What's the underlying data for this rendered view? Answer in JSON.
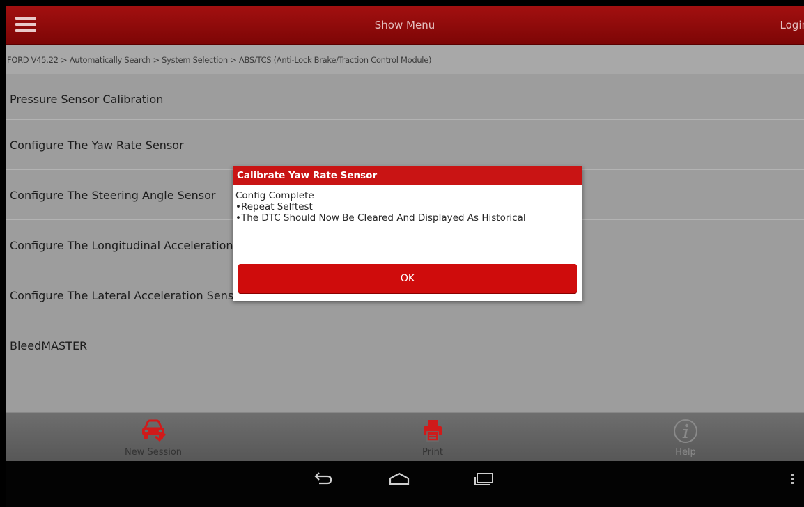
{
  "header": {
    "title": "Show Menu",
    "login_label": "Login"
  },
  "breadcrumb": "FORD V45.22 > Automatically Search > System Selection > ABS/TCS (Anti-Lock Brake/Traction Control Module)",
  "list": {
    "items": [
      {
        "label": "Pressure Sensor Calibration"
      },
      {
        "label": "Configure The Yaw Rate Sensor"
      },
      {
        "label": "Configure The Steering Angle Sensor"
      },
      {
        "label": "Configure The Longitudinal Acceleration Sensor"
      },
      {
        "label": "Configure The Lateral Acceleration Sensor"
      },
      {
        "label": "BleedMASTER"
      }
    ]
  },
  "dialog": {
    "title": "Calibrate Yaw Rate Sensor",
    "lines": [
      "Config Complete",
      "•Repeat Selftest",
      "•The DTC Should Now Be Cleared And Displayed As Historical"
    ],
    "ok_label": "OK"
  },
  "toolbar": {
    "new_session_label": "New Session",
    "print_label": "Print",
    "help_label": "Help"
  },
  "colors": {
    "brand_red": "#c91414",
    "header_red": "#8e0b0b"
  },
  "icons": {
    "menu": "hamburger-icon",
    "new_session": "car-icon",
    "print": "printer-icon",
    "help": "info-icon",
    "back": "back-icon",
    "home": "home-icon",
    "recents": "recents-icon",
    "overflow": "overflow-menu-icon"
  }
}
